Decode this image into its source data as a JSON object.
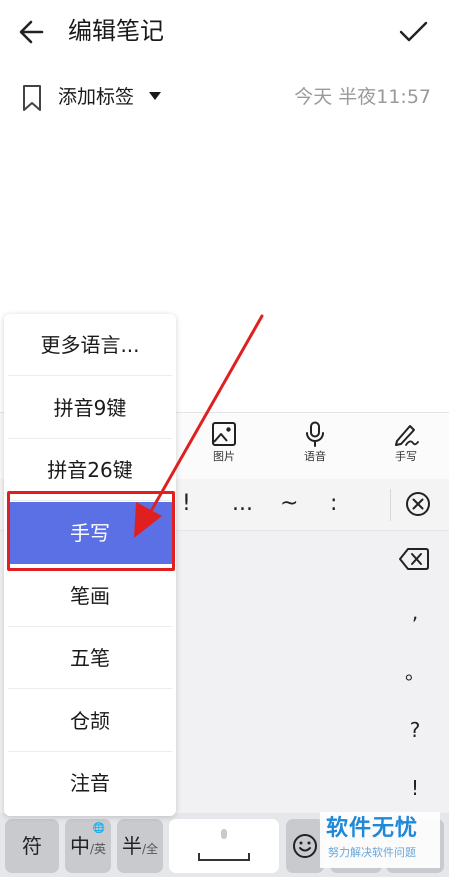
{
  "header": {
    "title": "编辑笔记",
    "back_icon": "back-arrow-icon",
    "confirm_icon": "check-icon"
  },
  "meta": {
    "tag_label": "添加标签",
    "timestamp": "今天 半夜11:57"
  },
  "toolbar": {
    "items": [
      {
        "label": "图片",
        "icon": "image-icon"
      },
      {
        "label": "语音",
        "icon": "microphone-icon"
      },
      {
        "label": "手写",
        "icon": "handwriting-pen-icon"
      }
    ]
  },
  "punctuation_row": [
    "!",
    "...",
    "~",
    ":"
  ],
  "side_keys": [
    ",",
    "。",
    "?",
    "!"
  ],
  "ime_menu": {
    "items": [
      "更多语言...",
      "拼音9键",
      "拼音26键",
      "手写",
      "笔画",
      "五笔",
      "仓颉",
      "注音"
    ],
    "selected": "手写"
  },
  "bottom_keys": {
    "symbol": "符",
    "zh_main": "中",
    "zh_sub": "/英",
    "half_main": "半",
    "half_sub": "/全",
    "globe": "🌐"
  },
  "colors": {
    "selected_bg": "#5b70e4",
    "annotation_red": "#e02020",
    "watermark_blue": "#1e88d9"
  },
  "watermark": {
    "title": "软件无忧",
    "subtitle": "努力解决软件问题"
  }
}
